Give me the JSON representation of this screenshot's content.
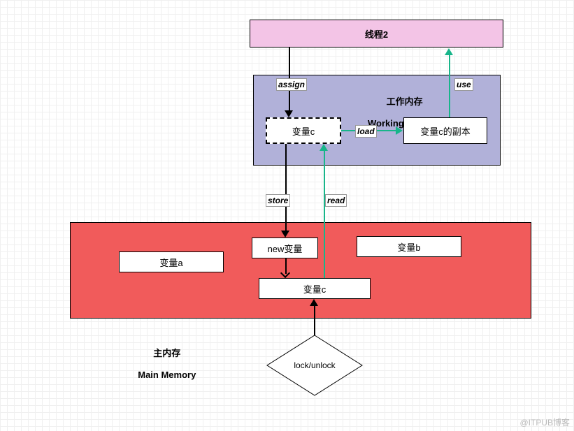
{
  "thread2": {
    "title": "线程2"
  },
  "workingMemory": {
    "title_cn": "工作内存",
    "title_en": "Working Memory",
    "var_c": "变量c",
    "var_c_copy": "变量c的副本"
  },
  "edges": {
    "assign": "assign",
    "use": "use",
    "load": "load",
    "store": "store",
    "read": "read"
  },
  "mainMemory": {
    "title_cn": "主内存",
    "title_en": "Main Memory",
    "var_a": "变量a",
    "var_b": "变量b",
    "new_var": "new变量",
    "var_c": "变量c"
  },
  "lock": {
    "label": "lock/unlock"
  },
  "watermark": "@ITPUB博客"
}
